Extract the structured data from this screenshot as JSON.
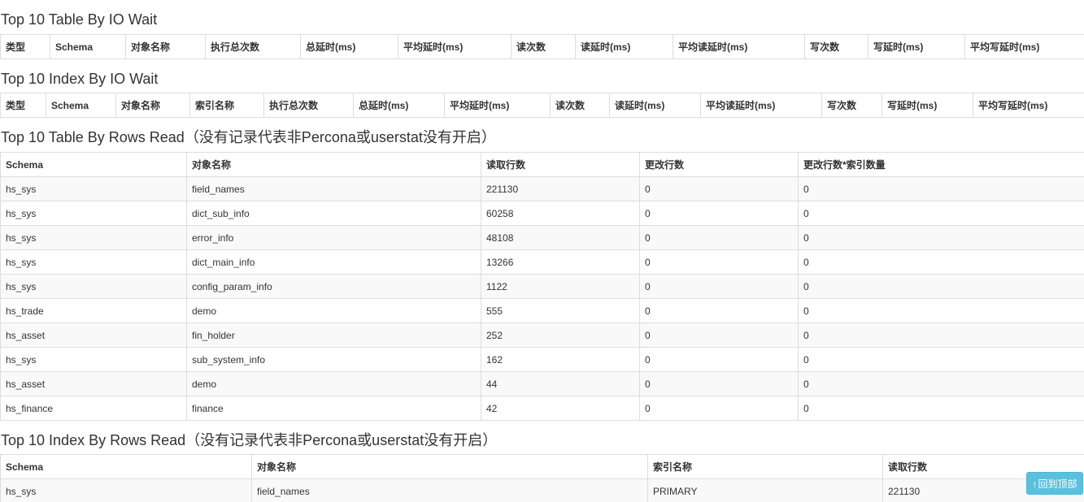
{
  "io_table": {
    "title": "Top 10 Table By IO Wait",
    "headers": [
      "类型",
      "Schema",
      "对象名称",
      "执行总次数",
      "总延时(ms)",
      "平均延时(ms)",
      "读次数",
      "读延时(ms)",
      "平均读延时(ms)",
      "写次数",
      "写延时(ms)",
      "平均写延时(ms)"
    ]
  },
  "io_index": {
    "title": "Top 10 Index By IO Wait",
    "headers": [
      "类型",
      "Schema",
      "对象名称",
      "索引名称",
      "执行总次数",
      "总延时(ms)",
      "平均延时(ms)",
      "读次数",
      "读延时(ms)",
      "平均读延时(ms)",
      "写次数",
      "写延时(ms)",
      "平均写延时(ms)"
    ]
  },
  "rows_table": {
    "title": "Top 10 Table By Rows Read",
    "note": "（没有记录代表非Percona或userstat没有开启）",
    "headers": [
      "Schema",
      "对象名称",
      "读取行数",
      "更改行数",
      "更改行数*索引数量"
    ],
    "rows": [
      [
        "hs_sys",
        "field_names",
        "221130",
        "0",
        "0"
      ],
      [
        "hs_sys",
        "dict_sub_info",
        "60258",
        "0",
        "0"
      ],
      [
        "hs_sys",
        "error_info",
        "48108",
        "0",
        "0"
      ],
      [
        "hs_sys",
        "dict_main_info",
        "13266",
        "0",
        "0"
      ],
      [
        "hs_sys",
        "config_param_info",
        "1122",
        "0",
        "0"
      ],
      [
        "hs_trade",
        "demo",
        "555",
        "0",
        "0"
      ],
      [
        "hs_asset",
        "fin_holder",
        "252",
        "0",
        "0"
      ],
      [
        "hs_sys",
        "sub_system_info",
        "162",
        "0",
        "0"
      ],
      [
        "hs_asset",
        "demo",
        "44",
        "0",
        "0"
      ],
      [
        "hs_finance",
        "finance",
        "42",
        "0",
        "0"
      ]
    ]
  },
  "rows_index": {
    "title": "Top 10 Index By Rows Read",
    "note": "（没有记录代表非Percona或userstat没有开启）",
    "headers": [
      "Schema",
      "对象名称",
      "索引名称",
      "读取行数"
    ],
    "rows": [
      [
        "hs_sys",
        "field_names",
        "PRIMARY",
        "221130"
      ]
    ]
  },
  "back_to_top": {
    "label": "回到顶部",
    "icon": "arrow-up-icon"
  },
  "colors": {
    "border": "#dddddd",
    "stripe": "#f9f9f9",
    "button": "#5bc0de"
  }
}
